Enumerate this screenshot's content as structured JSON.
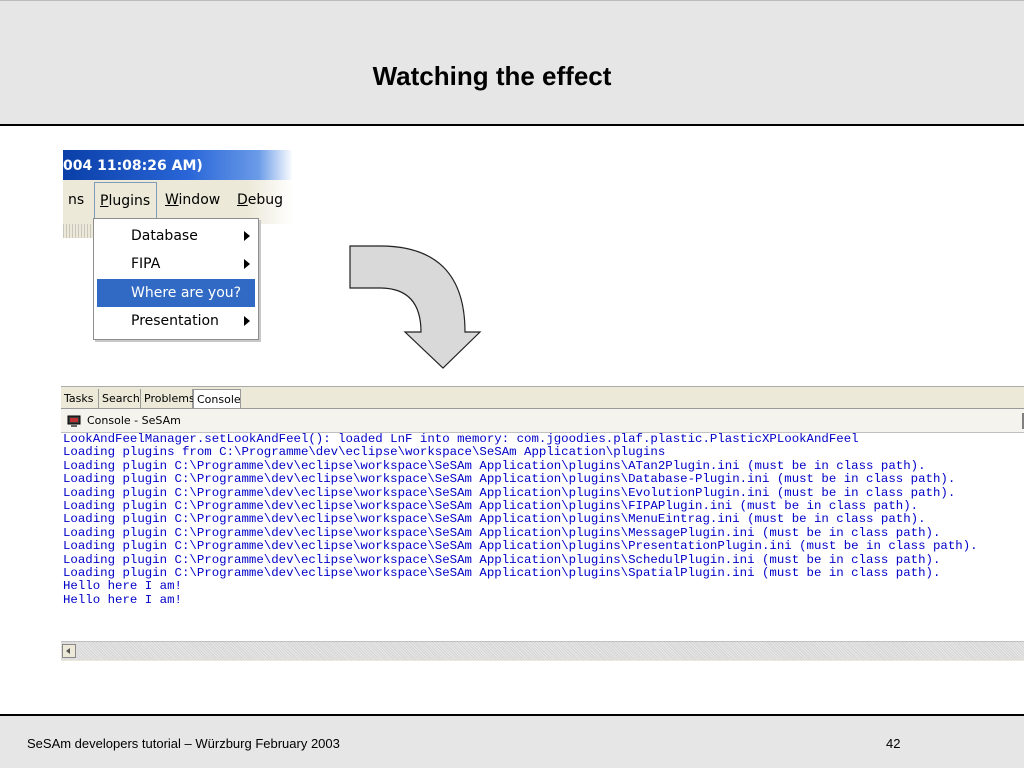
{
  "slide": {
    "title": "Watching the effect",
    "footer": "SeSAm developers tutorial  – Würzburg February 2003",
    "page_number": "42"
  },
  "menu_screenshot": {
    "titlebar_text": "004 11:08:26 AM)",
    "menubar": [
      {
        "label": "ns",
        "underline": ""
      },
      {
        "label": "lugins",
        "underline": "P"
      },
      {
        "label": "indow",
        "underline": "W"
      },
      {
        "label": "ebug",
        "underline": "D"
      }
    ],
    "dropdown_items": [
      {
        "label": "Database",
        "has_submenu": true
      },
      {
        "label": "FIPA",
        "has_submenu": true
      },
      {
        "label": "Where are you?",
        "has_submenu": false,
        "selected": true
      },
      {
        "label": "Presentation",
        "has_submenu": true
      }
    ]
  },
  "console_screenshot": {
    "tabs": [
      "Tasks",
      "Search",
      "Problems",
      "Console"
    ],
    "active_tab": "Console",
    "view_title": "Console - SeSAm",
    "icon": "console-icon",
    "lines": [
      "LookAndFeelManager.setLookAndFeel(): loaded LnF into memory: com.jgoodies.plaf.plastic.PlasticXPLookAndFeel",
      "Loading plugins from C:\\Programme\\dev\\eclipse\\workspace\\SeSAm Application\\plugins",
      "Loading plugin C:\\Programme\\dev\\eclipse\\workspace\\SeSAm Application\\plugins\\ATan2Plugin.ini (must be in class path).",
      "Loading plugin C:\\Programme\\dev\\eclipse\\workspace\\SeSAm Application\\plugins\\Database-Plugin.ini (must be in class path).",
      "Loading plugin C:\\Programme\\dev\\eclipse\\workspace\\SeSAm Application\\plugins\\EvolutionPlugin.ini (must be in class path).",
      "Loading plugin C:\\Programme\\dev\\eclipse\\workspace\\SeSAm Application\\plugins\\FIPAPlugin.ini (must be in class path).",
      "Loading plugin C:\\Programme\\dev\\eclipse\\workspace\\SeSAm Application\\plugins\\MenuEintrag.ini (must be in class path).",
      "Loading plugin C:\\Programme\\dev\\eclipse\\workspace\\SeSAm Application\\plugins\\MessagePlugin.ini (must be in class path).",
      "Loading plugin C:\\Programme\\dev\\eclipse\\workspace\\SeSAm Application\\plugins\\PresentationPlugin.ini (must be in class path).",
      "Loading plugin C:\\Programme\\dev\\eclipse\\workspace\\SeSAm Application\\plugins\\SchedulPlugin.ini (must be in class path).",
      "Loading plugin C:\\Programme\\dev\\eclipse\\workspace\\SeSAm Application\\plugins\\SpatialPlugin.ini (must be in class path).",
      "Hello here I am!",
      "Hello here I am!"
    ],
    "text_color": "#0000c8"
  },
  "arrow": {
    "icon": "curved-down-arrow-icon",
    "fill": "#d9d9d9"
  }
}
